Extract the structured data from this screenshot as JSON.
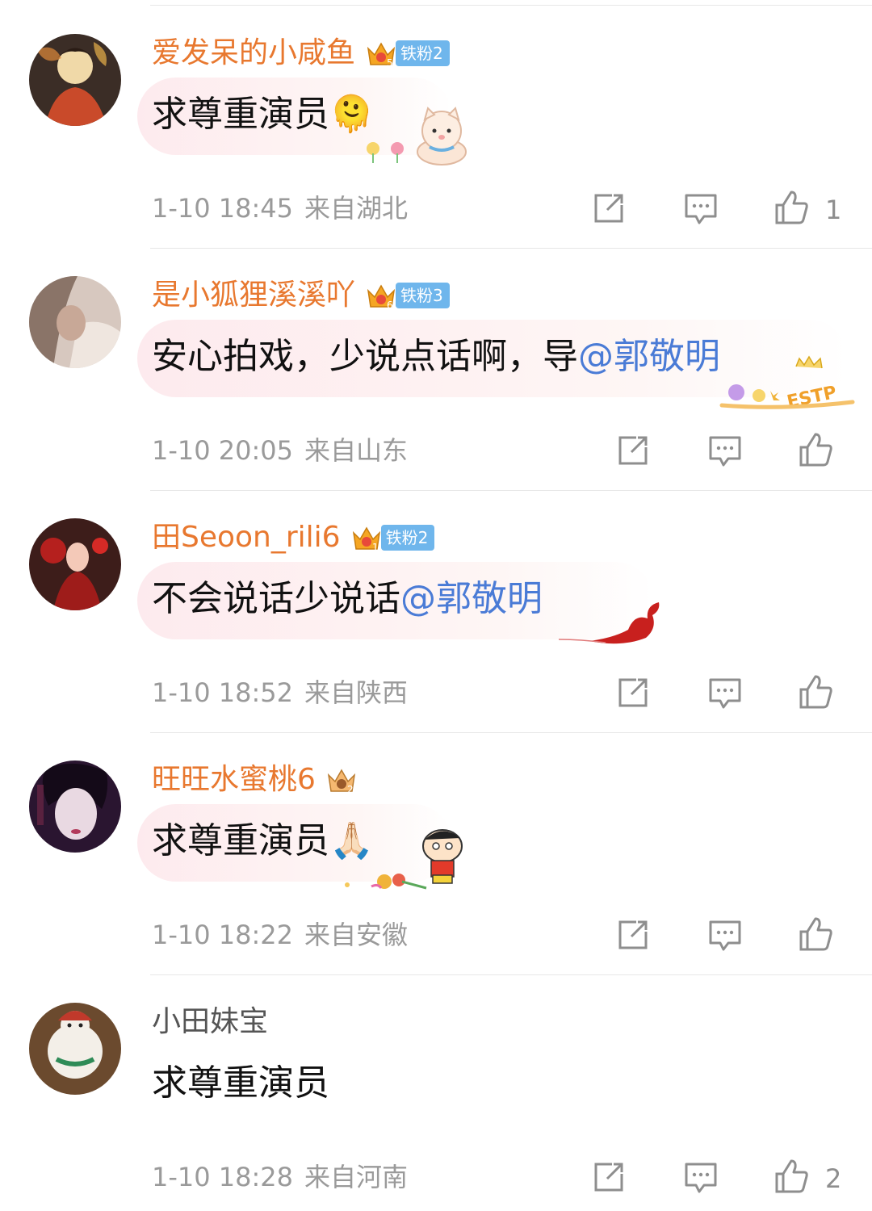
{
  "comments": [
    {
      "username": "爱发呆的小咸鱼",
      "fan_badge": "铁粉2",
      "text": "求尊重演员",
      "emoji": "🫠",
      "time": "1-10 18:45",
      "location": "来自湖北",
      "like_count": "1",
      "avatar_colors": [
        "#c94a2a",
        "#f0d9a8",
        "#3b2d26"
      ]
    },
    {
      "username": "是小狐狸溪溪吖",
      "fan_badge": "铁粉3",
      "text_before": "安心拍戏，少说点话啊，导",
      "mention": "@郭敬明",
      "decoration_text": "ESTP",
      "time": "1-10 20:05",
      "location": "来自山东",
      "avatar_colors": [
        "#d7c8bf",
        "#8a7468",
        "#efe6df"
      ]
    },
    {
      "username": "田Seoon_rili6",
      "fan_badge": "铁粉2",
      "text_before": "不会说话少说话",
      "mention": "@郭敬明",
      "time": "1-10 18:52",
      "location": "来自陕西",
      "avatar_colors": [
        "#b5201e",
        "#f4c9b8",
        "#3d1d1a"
      ]
    },
    {
      "username": "旺旺水蜜桃6",
      "text": "求尊重演员",
      "emoji": "🙏🏻",
      "time": "1-10 18:22",
      "location": "来自安徽",
      "avatar_colors": [
        "#2a1530",
        "#e9d9e2",
        "#7a2a4a"
      ]
    },
    {
      "username": "小田妹宝",
      "text": "求尊重演员",
      "time": "1-10 18:28",
      "location": "来自河南",
      "like_count": "2",
      "avatar_colors": [
        "#f3efe8",
        "#c0392b",
        "#6b4a2e"
      ]
    }
  ],
  "colors": {
    "username": "#e8782f",
    "mention": "#4a7bd6",
    "meta": "#9a9a9a",
    "fan_badge": "#6fb6ec"
  }
}
